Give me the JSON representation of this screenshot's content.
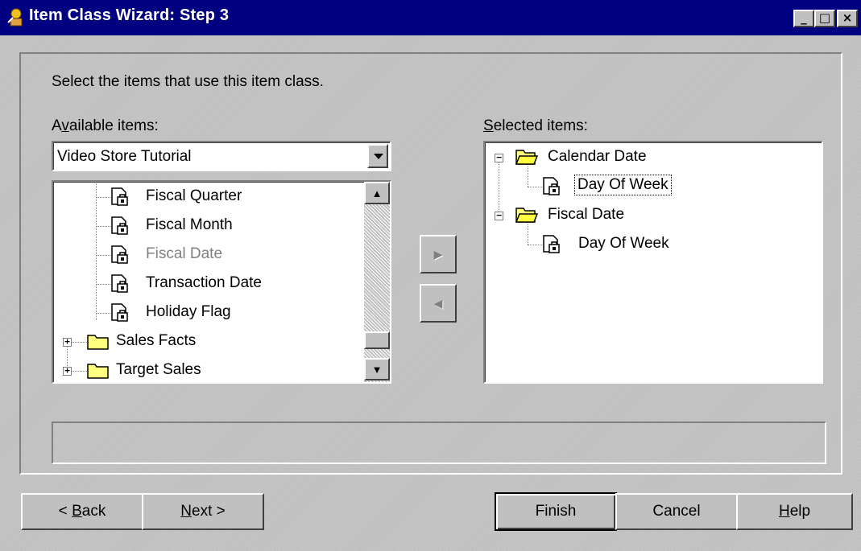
{
  "window": {
    "title": "Item Class Wizard: Step 3",
    "controls": {
      "minimize": "_",
      "maximize": "□",
      "close": "×"
    }
  },
  "instruction": "Select the items that use this item class.",
  "available": {
    "label_pre": "A",
    "label_key": "v",
    "label_post": "ailable items:",
    "dropdown_value": "Video Store Tutorial",
    "tree": [
      {
        "label": "Fiscal Quarter",
        "type": "item",
        "disabled": false
      },
      {
        "label": "Fiscal Month",
        "type": "item",
        "disabled": false
      },
      {
        "label": "Fiscal Date",
        "type": "item",
        "disabled": true
      },
      {
        "label": "Transaction Date",
        "type": "item",
        "disabled": false
      },
      {
        "label": "Holiday Flag",
        "type": "item",
        "disabled": false
      },
      {
        "label": "Sales Facts",
        "type": "folder",
        "expander": "+"
      },
      {
        "label": "Target Sales",
        "type": "folder",
        "expander": "+"
      }
    ],
    "scrollbar": {
      "up": "▲",
      "down": "▼"
    }
  },
  "transfer": {
    "add": "▶",
    "remove": "◀"
  },
  "selected": {
    "label_key": "S",
    "label_post": "elected items:",
    "tree": [
      {
        "label": "Calendar Date",
        "type": "folder",
        "expander": "−"
      },
      {
        "label": "Day Of Week",
        "type": "item",
        "focused": true
      },
      {
        "label": "Fiscal Date",
        "type": "folder",
        "expander": "−"
      },
      {
        "label": "Day Of Week",
        "type": "item",
        "focused": false
      }
    ]
  },
  "status_text": "",
  "buttons": {
    "back_pre": "< ",
    "back_key": "B",
    "back_post": "ack",
    "next_key": "N",
    "next_post": "ext >",
    "finish": "Finish",
    "cancel": "Cancel",
    "help_key": "H",
    "help_post": "elp"
  },
  "colors": {
    "titlebar": "#000080",
    "face": "#c0c0c0",
    "disabled_text": "#808080"
  }
}
